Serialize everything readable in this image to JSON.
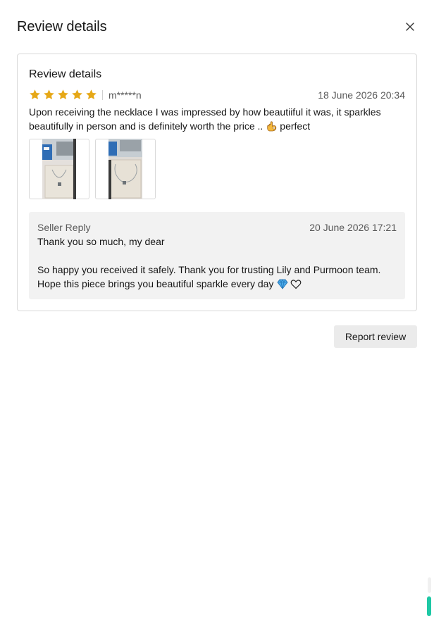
{
  "modal": {
    "title": "Review details",
    "close_icon": "close-icon"
  },
  "review": {
    "section_title": "Review details",
    "rating": 5,
    "rating_max": 5,
    "username": "m*****n",
    "date": "18 June 2026 20:34",
    "text_line1": "Upon receiving the necklace I was impressed by how beautiiful it was, it sparkles",
    "text_line2_before": "beautifully in person and is definitely worth the price ..",
    "text_line2_emoji": "ok-hand-emoji",
    "text_line2_after": "perfect",
    "photos": [
      {
        "icon": "review-photo-necklace-1"
      },
      {
        "icon": "review-photo-necklace-2"
      }
    ]
  },
  "seller_reply": {
    "label": "Seller Reply",
    "date": "20 June 2026 17:21",
    "line1": "Thank you so much, my dear",
    "line2": "So happy you received it safely. Thank you for trusting Lily and Purmoon team.",
    "line3_text": "Hope this piece brings you beautiful sparkle every day",
    "line3_emojis": [
      "gem-emoji",
      "heart-outline-emoji"
    ]
  },
  "actions": {
    "report_label": "Report review"
  },
  "colors": {
    "star": "#e6a817",
    "muted_text": "#595959",
    "reply_bg": "#f2f2f2",
    "button_bg": "#ebebeb",
    "scroll_accent": "#1ec8a5"
  }
}
